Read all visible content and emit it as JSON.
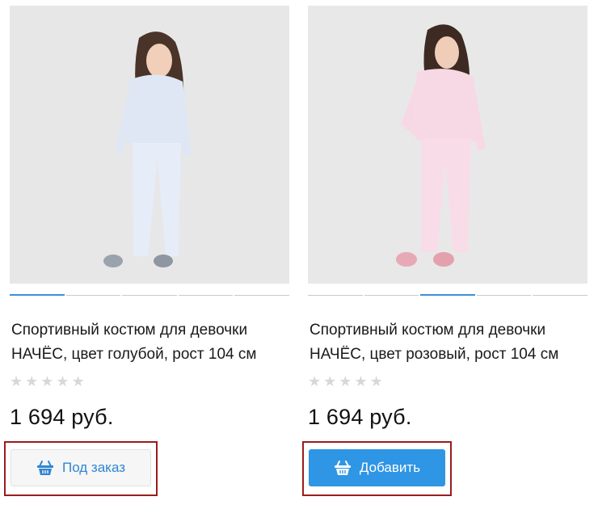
{
  "products": [
    {
      "title_line1": "Спортивный костюм для девочки",
      "title_line2": "НАЧЁС, цвет голубой, рост 104 см",
      "rating_stars": 0,
      "price": "1 694 руб.",
      "button_label": "Под заказ",
      "carousel_active_index": 0,
      "suit_color": "#dfe7f5",
      "button_style": "secondary"
    },
    {
      "title_line1": "Спортивный костюм для девочки",
      "title_line2": "НАЧЁС, цвет розовый, рост 104 см",
      "rating_stars": 0,
      "price": "1 694 руб.",
      "button_label": "Добавить",
      "carousel_active_index": 2,
      "suit_color": "#f7d9e6",
      "button_style": "primary"
    }
  ],
  "colors": {
    "accent_blue": "#2f95e5",
    "highlight_frame": "#9b1c1c",
    "star_empty": "#d8d8d8"
  },
  "icons": {
    "button_icon": "basket-icon",
    "rating_icon": "star-icon"
  }
}
